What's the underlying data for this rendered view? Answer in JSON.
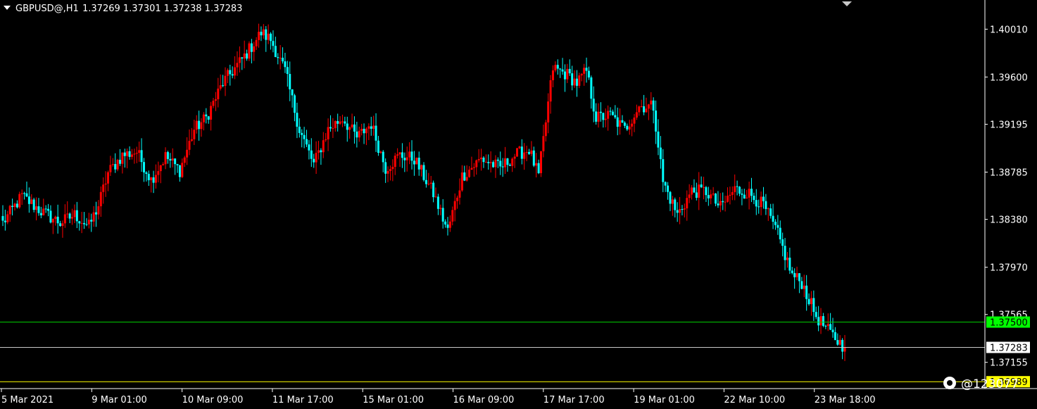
{
  "header": {
    "symbol": "GBPUSD@,H1",
    "ohlc": "1.37269 1.37301 1.37238 1.37283"
  },
  "chart_data": {
    "type": "candlestick",
    "symbol": "GBPUSD@",
    "timeframe": "H1",
    "ylim": [
      1.3693,
      1.4026
    ],
    "y_ticks": [
      "1.40010",
      "1.39600",
      "1.39195",
      "1.38785",
      "1.38380",
      "1.37970",
      "1.37565",
      "1.37155"
    ],
    "x_labels": [
      "5 Mar 2021",
      "9 Mar 01:00",
      "10 Mar 09:00",
      "11 Mar 17:00",
      "15 Mar 01:00",
      "16 Mar 09:00",
      "17 Mar 17:00",
      "19 Mar 01:00",
      "22 Mar 10:00",
      "23 Mar 18:00"
    ],
    "bull_color": "#ff0000",
    "bear_color": "#00ffff",
    "grid": false,
    "anchors": [
      [
        0,
        1.3835
      ],
      [
        8,
        1.3858
      ],
      [
        16,
        1.3845
      ],
      [
        24,
        1.3835
      ],
      [
        30,
        1.3842
      ],
      [
        36,
        1.3832
      ],
      [
        40,
        1.385
      ],
      [
        44,
        1.3878
      ],
      [
        50,
        1.3893
      ],
      [
        56,
        1.3896
      ],
      [
        62,
        1.3872
      ],
      [
        68,
        1.3892
      ],
      [
        74,
        1.388
      ],
      [
        80,
        1.3915
      ],
      [
        85,
        1.3925
      ],
      [
        92,
        1.3955
      ],
      [
        100,
        1.3975
      ],
      [
        108,
        1.3998
      ],
      [
        112,
        1.3992
      ],
      [
        118,
        1.3965
      ],
      [
        124,
        1.3915
      ],
      [
        130,
        1.3885
      ],
      [
        136,
        1.3915
      ],
      [
        142,
        1.3925
      ],
      [
        148,
        1.3908
      ],
      [
        154,
        1.392
      ],
      [
        160,
        1.3882
      ],
      [
        166,
        1.3893
      ],
      [
        172,
        1.389
      ],
      [
        180,
        1.386
      ],
      [
        186,
        1.3828
      ],
      [
        192,
        1.3875
      ],
      [
        200,
        1.389
      ],
      [
        208,
        1.3882
      ],
      [
        214,
        1.3893
      ],
      [
        220,
        1.3898
      ],
      [
        224,
        1.3875
      ],
      [
        230,
        1.3968
      ],
      [
        236,
        1.3962
      ],
      [
        240,
        1.3955
      ],
      [
        244,
        1.3965
      ],
      [
        248,
        1.3925
      ],
      [
        254,
        1.3927
      ],
      [
        260,
        1.3915
      ],
      [
        266,
        1.3935
      ],
      [
        272,
        1.3935
      ],
      [
        276,
        1.387
      ],
      [
        282,
        1.3842
      ],
      [
        288,
        1.3862
      ],
      [
        294,
        1.3862
      ],
      [
        300,
        1.3848
      ],
      [
        306,
        1.3864
      ],
      [
        312,
        1.386
      ],
      [
        318,
        1.385
      ],
      [
        324,
        1.3825
      ],
      [
        330,
        1.379
      ],
      [
        334,
        1.3784
      ],
      [
        340,
        1.3755
      ],
      [
        346,
        1.374
      ],
      [
        352,
        1.3728
      ]
    ],
    "last_price": 1.37283,
    "levels": [
      {
        "price": 1.375,
        "label": "1.37500",
        "line_color": "#00cc00",
        "badge_bg": "#00ff00",
        "badge_fg": "#000000"
      },
      {
        "price": 1.37283,
        "label": "1.37283",
        "line_color": "#c8c8c8",
        "badge_bg": "#ffffff",
        "badge_fg": "#000000"
      },
      {
        "price": 1.36989,
        "label": "1.36989",
        "line_color": "#ffff00",
        "badge_bg": "#ffff00",
        "badge_fg": "#000000"
      }
    ]
  },
  "watermark": {
    "text": "@123077"
  }
}
